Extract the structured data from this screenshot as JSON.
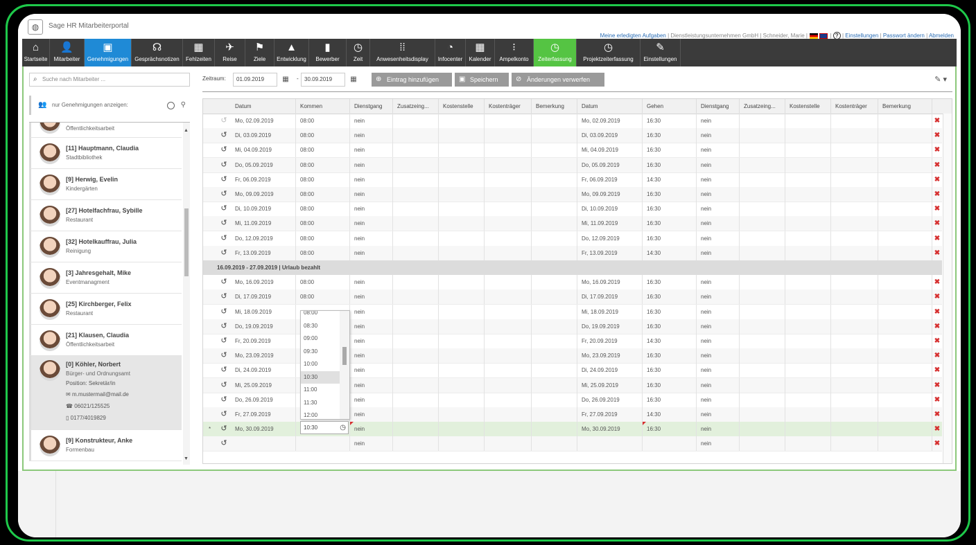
{
  "app": {
    "title": "Sage HR Mitarbeiterportal"
  },
  "toplinks": {
    "tasks": "Meine erledigten Aufgaben",
    "company": "Dienstleistungsunternehmen GmbH",
    "user": "Schneider, Marie",
    "help": "?",
    "settings": "Einstellungen",
    "password": "Passwort ändern",
    "logout": "Abmelden"
  },
  "nav": [
    {
      "label": "Startseite",
      "icon": "home-icon",
      "glyph": "⌂"
    },
    {
      "label": "Mitarbeiter",
      "icon": "person-icon",
      "glyph": "👤"
    },
    {
      "label": "Genehmigungen",
      "icon": "approvals-icon",
      "glyph": "▣"
    },
    {
      "label": "Gesprächsnotizen",
      "icon": "notes-icon",
      "glyph": "☊"
    },
    {
      "label": "Fehlzeiten",
      "icon": "calendar-icon",
      "glyph": "▦"
    },
    {
      "label": "Reise",
      "icon": "airplane-icon",
      "glyph": "✈"
    },
    {
      "label": "Ziele",
      "icon": "flag-icon",
      "glyph": "⚑"
    },
    {
      "label": "Entwicklung",
      "icon": "chart-icon",
      "glyph": "▲"
    },
    {
      "label": "Bewerber",
      "icon": "applicants-icon",
      "glyph": "▮"
    },
    {
      "label": "Zeit",
      "icon": "clock-calendar-icon",
      "glyph": "◷"
    },
    {
      "label": "Anwesenheitsdisplay",
      "icon": "grid-icon",
      "glyph": "⁞⁞"
    },
    {
      "label": "Infocenter",
      "icon": "pie-icon",
      "glyph": "◔"
    },
    {
      "label": "Kalender",
      "icon": "calendar-icon",
      "glyph": "▦"
    },
    {
      "label": "Ampelkonto",
      "icon": "traffic-light-icon",
      "glyph": "⁝"
    },
    {
      "label": "Zeiterfassung",
      "icon": "time-tracking-icon",
      "glyph": "◷"
    },
    {
      "label": "Projektzeiterfassung",
      "icon": "project-time-icon",
      "glyph": "◷"
    },
    {
      "label": "Einstellungen",
      "icon": "wrench-icon",
      "glyph": "✎"
    }
  ],
  "colors": {
    "active_nav": "#1f8ad6",
    "active_time": "#55c443",
    "accent_green": "#1ec94a"
  },
  "left": {
    "search_placeholder": "Suche nach Mitarbeiter ...",
    "filter_label": "nur Genehmigungen anzeigen:",
    "employees": [
      {
        "name": "",
        "dept": "Öffentlichkeitsarbeit"
      },
      {
        "name": "[11] Hauptmann, Claudia",
        "dept": "Stadtbibliothek"
      },
      {
        "name": "[9] Herwig, Evelin",
        "dept": "Kindergärten"
      },
      {
        "name": "[27] Hotelfachfrau, Sybille",
        "dept": "Restaurant"
      },
      {
        "name": "[32] Hotelkauffrau, Julia",
        "dept": "Reinigung"
      },
      {
        "name": "[3] Jahresgehalt, Mike",
        "dept": "Eventmanagment"
      },
      {
        "name": "[25] Kirchberger, Felix",
        "dept": "Restaurant"
      },
      {
        "name": "[21] Klausen, Claudia",
        "dept": "Öffentlichkeitsarbeit"
      },
      {
        "name": "[0] Köhler, Norbert",
        "dept": "Bürger- und Ordnungsamt",
        "position": "Position:  Sekretär/in",
        "email": "m.mustermail@mail.de",
        "phone": "06021/125525",
        "mobile": "0177/4019829"
      },
      {
        "name": "[9] Konstrukteur, Anke",
        "dept": "Formenbau"
      }
    ]
  },
  "toolbar": {
    "zeitraum_label": "Zeitraum:",
    "from": "01.09.2019",
    "to": "30.09.2019",
    "dash": "-",
    "add": "Eintrag hinzufügen",
    "save": "Speichern",
    "discard": "Änderungen verwerfen"
  },
  "grid": {
    "headers": [
      "Datum",
      "Kommen",
      "Dienstgang",
      "Zusatzeing...",
      "Kostenstelle",
      "Kostenträger",
      "Bemerkung",
      "Datum",
      "Gehen",
      "Dienstgang",
      "Zusatzeing...",
      "Kostenstelle",
      "Kostenträger",
      "Bemerkung"
    ],
    "group_label": "16.09.2019 - 27.09.2019 | Urlaub bezahlt",
    "rows1": [
      {
        "d1": "Mo, 02.09.2019",
        "k": "08:00",
        "dg": "nein",
        "d2": "Mo, 02.09.2019",
        "g": "16:30",
        "dg2": "nein"
      },
      {
        "d1": "Di, 03.09.2019",
        "k": "08:00",
        "dg": "nein",
        "d2": "Di, 03.09.2019",
        "g": "16:30",
        "dg2": "nein"
      },
      {
        "d1": "Mi, 04.09.2019",
        "k": "08:00",
        "dg": "nein",
        "d2": "Mi, 04.09.2019",
        "g": "16:30",
        "dg2": "nein"
      },
      {
        "d1": "Do, 05.09.2019",
        "k": "08:00",
        "dg": "nein",
        "d2": "Do, 05.09.2019",
        "g": "16:30",
        "dg2": "nein"
      },
      {
        "d1": "Fr, 06.09.2019",
        "k": "08:00",
        "dg": "nein",
        "d2": "Fr, 06.09.2019",
        "g": "14:30",
        "dg2": "nein"
      },
      {
        "d1": "Mo, 09.09.2019",
        "k": "08:00",
        "dg": "nein",
        "d2": "Mo, 09.09.2019",
        "g": "16:30",
        "dg2": "nein"
      },
      {
        "d1": "Di, 10.09.2019",
        "k": "08:00",
        "dg": "nein",
        "d2": "Di, 10.09.2019",
        "g": "16:30",
        "dg2": "nein"
      },
      {
        "d1": "Mi, 11.09.2019",
        "k": "08:00",
        "dg": "nein",
        "d2": "Mi, 11.09.2019",
        "g": "16:30",
        "dg2": "nein"
      },
      {
        "d1": "Do, 12.09.2019",
        "k": "08:00",
        "dg": "nein",
        "d2": "Do, 12.09.2019",
        "g": "16:30",
        "dg2": "nein"
      },
      {
        "d1": "Fr, 13.09.2019",
        "k": "08:00",
        "dg": "nein",
        "d2": "Fr, 13.09.2019",
        "g": "14:30",
        "dg2": "nein"
      }
    ],
    "rows2": [
      {
        "d1": "Mo, 16.09.2019",
        "k": "08:00",
        "dg": "nein",
        "d2": "Mo, 16.09.2019",
        "g": "16:30",
        "dg2": "nein"
      },
      {
        "d1": "Di, 17.09.2019",
        "k": "08:00",
        "dg": "nein",
        "d2": "Di, 17.09.2019",
        "g": "16:30",
        "dg2": "nein"
      },
      {
        "d1": "Mi, 18.09.2019",
        "k": "",
        "dg": "nein",
        "d2": "Mi, 18.09.2019",
        "g": "16:30",
        "dg2": "nein"
      },
      {
        "d1": "Do, 19.09.2019",
        "k": "",
        "dg": "nein",
        "d2": "Do, 19.09.2019",
        "g": "16:30",
        "dg2": "nein"
      },
      {
        "d1": "Fr, 20.09.2019",
        "k": "",
        "dg": "nein",
        "d2": "Fr, 20.09.2019",
        "g": "14:30",
        "dg2": "nein"
      },
      {
        "d1": "Mo, 23.09.2019",
        "k": "",
        "dg": "nein",
        "d2": "Mo, 23.09.2019",
        "g": "16:30",
        "dg2": "nein"
      },
      {
        "d1": "Di, 24.09.2019",
        "k": "",
        "dg": "nein",
        "d2": "Di, 24.09.2019",
        "g": "16:30",
        "dg2": "nein"
      },
      {
        "d1": "Mi, 25.09.2019",
        "k": "",
        "dg": "nein",
        "d2": "Mi, 25.09.2019",
        "g": "16:30",
        "dg2": "nein"
      },
      {
        "d1": "Do, 26.09.2019",
        "k": "",
        "dg": "nein",
        "d2": "Do, 26.09.2019",
        "g": "16:30",
        "dg2": "nein"
      },
      {
        "d1": "Fr, 27.09.2019",
        "k": "",
        "dg": "nein",
        "d2": "Fr, 27.09.2019",
        "g": "14:30",
        "dg2": "nein"
      },
      {
        "d1": "Mo, 30.09.2019",
        "k": "",
        "dg": "nein",
        "d2": "Mo, 30.09.2019",
        "g": "16:30",
        "dg2": "nein"
      },
      {
        "d1": "",
        "k": "",
        "dg": "nein",
        "d2": "",
        "g": "",
        "dg2": "nein"
      }
    ],
    "edit_marker": "*",
    "time_options": [
      "08:00",
      "08:30",
      "09:00",
      "09:30",
      "10:00",
      "10:30",
      "11:00",
      "11:30",
      "12:00"
    ],
    "time_input_value": "10:30"
  }
}
